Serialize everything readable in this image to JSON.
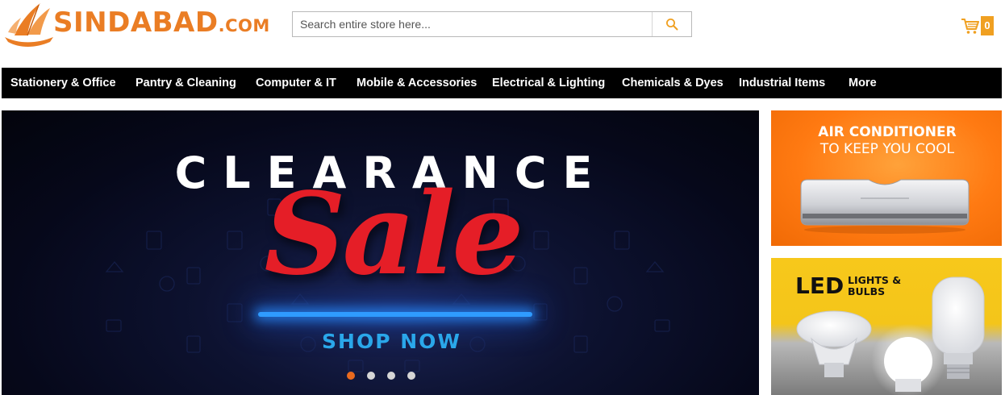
{
  "header": {
    "logo": {
      "main": "SINDABAD",
      "suffix": ".COM"
    },
    "search": {
      "placeholder": "Search entire store here..."
    },
    "cart": {
      "count": "0"
    }
  },
  "nav": {
    "items": [
      "Stationery & Office",
      "Pantry & Cleaning",
      "Computer & IT",
      "Mobile & Accessories",
      "Electrical & Lighting",
      "Chemicals & Dyes",
      "Industrial Items",
      "More"
    ]
  },
  "hero": {
    "headline": "CLEARANCE",
    "sale": "Sale",
    "cta": "SHOP NOW",
    "slides": {
      "count": 4,
      "active": 1
    }
  },
  "banners": {
    "ac": {
      "line1": "AIR CONDITIONER",
      "line2": "TO KEEP YOU COOL"
    },
    "led": {
      "big": "LED",
      "small1": "LIGHTS &",
      "small2": "BULBS"
    }
  },
  "colors": {
    "brand": "#ea7d24",
    "nav_bg": "#000000",
    "cart_badge": "#f0a021",
    "sale_red": "#e51e27",
    "shop_blue": "#2aa7ea",
    "dot_active": "#ea6a1e"
  }
}
